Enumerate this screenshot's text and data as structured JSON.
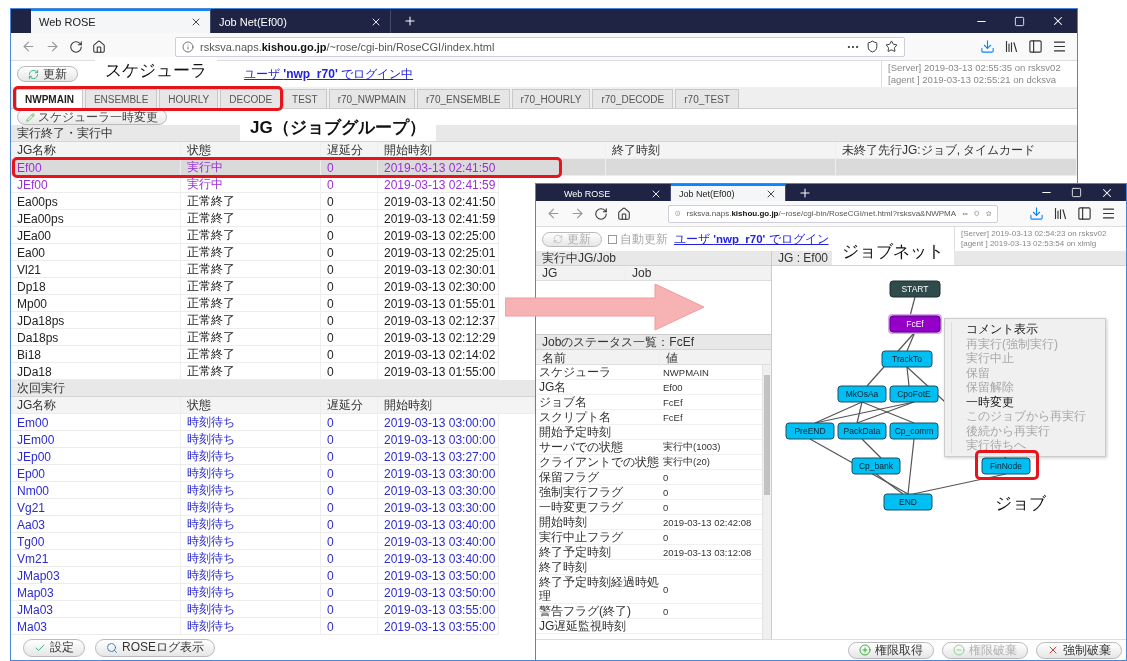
{
  "main_window": {
    "browser_tabs": [
      {
        "label": "Web ROSE",
        "selected": true
      },
      {
        "label": "Job Net(Ef00)",
        "selected": false
      }
    ],
    "url": "rsksva.naps.**kishou.go.jp**/~rose/cgi-bin/RoseCGI/index.html",
    "refresh_button": "更新",
    "login_link": "ユーザ **'nwp_r70'** でログイン中",
    "server_info": [
      "[Server] 2019-03-13 02:55:35 on rsksv02",
      "[agent ] 2019-03-13 02:55:21 on dcksva"
    ],
    "scheduler_tabs": [
      {
        "label": "NWPMAIN",
        "selected": true
      },
      {
        "label": "ENSEMBLE",
        "selected": false
      },
      {
        "label": "HOURLY",
        "selected": false
      },
      {
        "label": "DECODE",
        "selected": false
      },
      {
        "label": "TEST",
        "selected": false
      },
      {
        "label": "r70_NWPMAIN",
        "selected": false
      },
      {
        "label": "r70_ENSEMBLE",
        "selected": false
      },
      {
        "label": "r70_HOURLY",
        "selected": false
      },
      {
        "label": "r70_DECODE",
        "selected": false
      },
      {
        "label": "r70_TEST",
        "selected": false
      }
    ],
    "schedule_change_button": "スケジューラ一時変更",
    "sections": [
      {
        "title": "実行終了・実行中",
        "columns": [
          "JG名称",
          "状態",
          "遅延分",
          "開始時刻",
          "終了時刻",
          "未終了先行JG:ジョブ, タイムカード"
        ],
        "rows": [
          {
            "cells": [
              "Ef00",
              "実行中",
              "0",
              "2019-03-13 02:41:50"
            ],
            "kind": "running",
            "selected": true
          },
          {
            "cells": [
              "JEf00",
              "実行中",
              "0",
              "2019-03-13 02:41:59"
            ],
            "kind": "running",
            "selected": false
          },
          {
            "cells": [
              "Ea00ps",
              "正常終了",
              "0",
              "2019-03-13 02:41:50"
            ],
            "kind": "done",
            "selected": false
          },
          {
            "cells": [
              "JEa00ps",
              "正常終了",
              "0",
              "2019-03-13 02:41:59"
            ],
            "kind": "done",
            "selected": false
          },
          {
            "cells": [
              "JEa00",
              "正常終了",
              "0",
              "2019-03-13 02:25:00"
            ],
            "kind": "done",
            "selected": false
          },
          {
            "cells": [
              "Ea00",
              "正常終了",
              "0",
              "2019-03-13 02:25:01"
            ],
            "kind": "done",
            "selected": false
          },
          {
            "cells": [
              "Vl21",
              "正常終了",
              "0",
              "2019-03-13 02:30:01"
            ],
            "kind": "done",
            "selected": false
          },
          {
            "cells": [
              "Dp18",
              "正常終了",
              "0",
              "2019-03-13 02:30:00"
            ],
            "kind": "done",
            "selected": false
          },
          {
            "cells": [
              "Mp00",
              "正常終了",
              "0",
              "2019-03-13 01:55:01"
            ],
            "kind": "done",
            "selected": false
          },
          {
            "cells": [
              "JDa18ps",
              "正常終了",
              "0",
              "2019-03-13 02:12:37"
            ],
            "kind": "done",
            "selected": false
          },
          {
            "cells": [
              "Da18ps",
              "正常終了",
              "0",
              "2019-03-13 02:12:29"
            ],
            "kind": "done",
            "selected": false
          },
          {
            "cells": [
              "Bi18",
              "正常終了",
              "0",
              "2019-03-13 02:14:02"
            ],
            "kind": "done",
            "selected": false
          },
          {
            "cells": [
              "JDa18",
              "正常終了",
              "0",
              "2019-03-13 01:55:00"
            ],
            "kind": "done",
            "selected": false
          }
        ]
      },
      {
        "title": "次回実行",
        "columns": [
          "JG名称",
          "状態",
          "遅延分",
          "開始時刻"
        ],
        "rows": [
          {
            "cells": [
              "Em00",
              "時刻待ち",
              "0",
              "2019-03-13 03:00:00"
            ],
            "kind": "waiting",
            "selected": false
          },
          {
            "cells": [
              "JEm00",
              "時刻待ち",
              "0",
              "2019-03-13 03:00:00"
            ],
            "kind": "waiting",
            "selected": false
          },
          {
            "cells": [
              "JEp00",
              "時刻待ち",
              "0",
              "2019-03-13 03:27:00"
            ],
            "kind": "waiting",
            "selected": false
          },
          {
            "cells": [
              "Ep00",
              "時刻待ち",
              "0",
              "2019-03-13 03:30:00"
            ],
            "kind": "waiting",
            "selected": false
          },
          {
            "cells": [
              "Nm00",
              "時刻待ち",
              "0",
              "2019-03-13 03:30:00"
            ],
            "kind": "waiting",
            "selected": false
          },
          {
            "cells": [
              "Vg21",
              "時刻待ち",
              "0",
              "2019-03-13 03:30:00"
            ],
            "kind": "waiting",
            "selected": false
          },
          {
            "cells": [
              "Aa03",
              "時刻待ち",
              "0",
              "2019-03-13 03:40:00"
            ],
            "kind": "waiting",
            "selected": false
          },
          {
            "cells": [
              "Tg00",
              "時刻待ち",
              "0",
              "2019-03-13 03:40:00"
            ],
            "kind": "waiting",
            "selected": false
          },
          {
            "cells": [
              "Vm21",
              "時刻待ち",
              "0",
              "2019-03-13 03:40:00"
            ],
            "kind": "waiting",
            "selected": false
          },
          {
            "cells": [
              "JMap03",
              "時刻待ち",
              "0",
              "2019-03-13 03:50:00"
            ],
            "kind": "waiting",
            "selected": false
          },
          {
            "cells": [
              "Map03",
              "時刻待ち",
              "0",
              "2019-03-13 03:50:00"
            ],
            "kind": "waiting",
            "selected": false
          },
          {
            "cells": [
              "JMa03",
              "時刻待ち",
              "0",
              "2019-03-13 03:55:00"
            ],
            "kind": "waiting",
            "selected": false
          },
          {
            "cells": [
              "Ma03",
              "時刻待ち",
              "0",
              "2019-03-13 03:55:00"
            ],
            "kind": "waiting",
            "selected": false
          }
        ]
      }
    ],
    "footer_buttons": [
      {
        "label": "設定",
        "kind": "settings"
      },
      {
        "label": "ROSEログ表示",
        "kind": "log"
      }
    ]
  },
  "jobnet_window": {
    "browser_tabs": [
      {
        "label": "Web ROSE",
        "selected": false
      },
      {
        "label": "Job Net(Ef00)",
        "selected": true
      }
    ],
    "url": "rsksva.naps.**kishou.go.jp**/~rose/cgi-bin/RoseCGI/net.html?rsksva&NWPMA",
    "refresh_button": {
      "label": "更新",
      "disabled": true
    },
    "auto_refresh": {
      "label": "自動更新",
      "checked": false
    },
    "login_link": "ユーザ **'nwp_r70'** でログイン",
    "server_info": [
      "[Server] 2019-03-13 02:54:23 on rsksv02",
      "[agent ] 2019-03-13 02:53:54 on xlmlg"
    ],
    "running_panel": {
      "title": "実行中JG/Job",
      "columns": [
        "JG",
        "Job"
      ]
    },
    "graph_panel": {
      "title": "JG : Ef00"
    },
    "status_panel": {
      "title": "Jobのステータス一覧：FcEf",
      "columns": [
        "名前",
        "値"
      ],
      "rows": [
        {
          "name": "スケジューラ",
          "value": "NWPMAIN"
        },
        {
          "name": "JG名",
          "value": "Ef00"
        },
        {
          "name": "ジョブ名",
          "value": "FcEf"
        },
        {
          "name": "スクリプト名",
          "value": "FcEf"
        },
        {
          "name": "開始予定時刻"
        },
        {
          "name": "サーバでの状態",
          "value": "実行中(1003)"
        },
        {
          "name": "クライアントでの状態",
          "value": "実行中(20)"
        },
        {
          "name": "保留フラグ",
          "value": "0"
        },
        {
          "name": "強制実行フラグ",
          "value": "0"
        },
        {
          "name": "一時変更フラグ",
          "value": "0"
        },
        {
          "name": "開始時刻",
          "value": "2019-03-13 02:42:08"
        },
        {
          "name": "実行中止フラグ",
          "value": "0"
        },
        {
          "name": "終了予定時刻",
          "value": "2019-03-13 03:12:08"
        },
        {
          "name": "終了時刻"
        },
        {
          "name": "終了予定時刻経過時処理",
          "value": "0"
        },
        {
          "name": "警告フラグ(終了)",
          "value": "0"
        },
        {
          "name": "JG遅延監視時刻"
        }
      ]
    },
    "jobnet": {
      "nodes": [
        {
          "label": "START",
          "kind": "start"
        },
        {
          "label": "FcEf",
          "kind": "running"
        },
        {
          "label": "TrackTo",
          "kind": "waiting"
        },
        {
          "label": "MkOsAa",
          "kind": "waiting"
        },
        {
          "label": "CpoFotE",
          "kind": "waiting"
        },
        {
          "label": "PreEND",
          "kind": "waiting"
        },
        {
          "label": "PackData",
          "kind": "waiting"
        },
        {
          "label": "Cp_comm",
          "kind": "waiting"
        },
        {
          "label": "Cp_bank",
          "kind": "waiting"
        },
        {
          "label": "FinNode",
          "kind": "waiting"
        },
        {
          "label": "END",
          "kind": "waiting"
        }
      ]
    },
    "context_menu": [
      {
        "label": "コメント表示",
        "disabled": false
      },
      {
        "label": "再実行(強制実行)",
        "disabled": true
      },
      {
        "label": "実行中止",
        "disabled": true
      },
      {
        "label": "保留",
        "disabled": true
      },
      {
        "label": "保留解除",
        "disabled": true
      },
      {
        "label": "一時変更",
        "disabled": false
      },
      {
        "label": "このジョブから再実行",
        "disabled": true
      },
      {
        "label": "後続から再実行",
        "disabled": true
      },
      {
        "label": "実行待ちへ",
        "disabled": true
      }
    ],
    "buttons": [
      {
        "label": "権限取得",
        "kind": "acquire",
        "disabled": false
      },
      {
        "label": "権限破棄",
        "kind": "release",
        "disabled": true
      },
      {
        "label": "強制破棄",
        "kind": "force",
        "disabled": false
      }
    ]
  },
  "annotations": [
    {
      "kind": "label",
      "text": "スケジューラ"
    },
    {
      "kind": "frame"
    },
    {
      "kind": "label",
      "text": "JG（ジョブグループ）"
    },
    {
      "kind": "frame"
    },
    {
      "kind": "label",
      "text": "ジョブネット"
    },
    {
      "kind": "frame"
    },
    {
      "kind": "label",
      "text": "ジョブ"
    },
    {
      "kind": "arrow"
    }
  ]
}
